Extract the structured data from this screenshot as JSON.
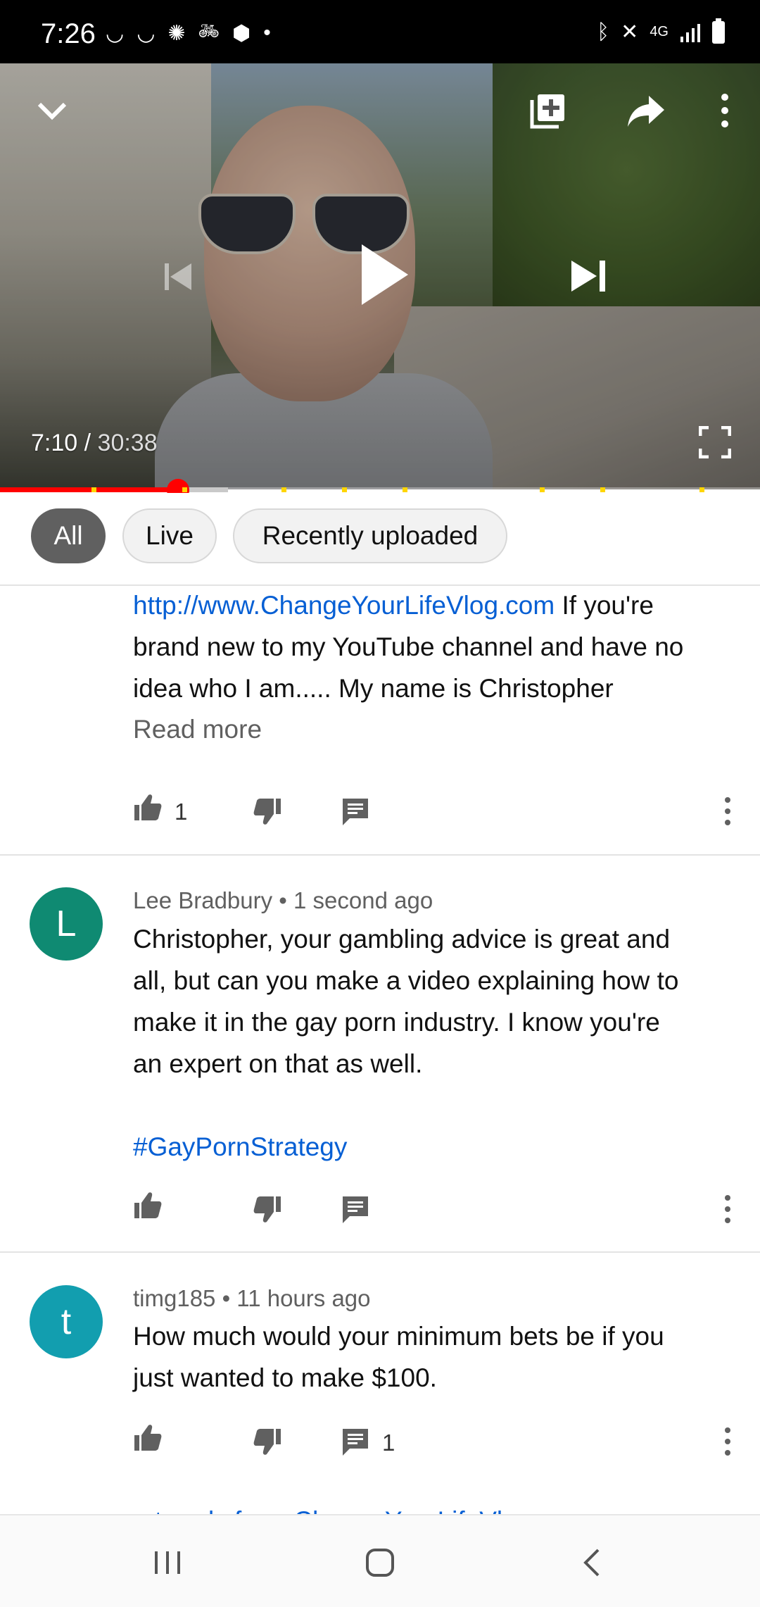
{
  "status_bar": {
    "time": "7:26",
    "left_icons": [
      "moon-icon",
      "moon-icon",
      "sync-icon",
      "bike-icon",
      "bank-icon",
      "dot-icon"
    ],
    "right_icons": [
      "bluetooth-icon",
      "mute-icon",
      "4g-icon",
      "signal-icon",
      "battery-icon"
    ],
    "network_label": "4G"
  },
  "player": {
    "current_time": "7:10",
    "separator": " / ",
    "duration": "30:38",
    "progress_fraction": 0.234,
    "buffered_fraction": 0.3,
    "ad_markers": [
      0.12,
      0.24,
      0.37,
      0.45,
      0.53,
      0.71,
      0.79,
      0.92
    ],
    "accent_color": "#ff0000",
    "marker_color": "#ffd600"
  },
  "filters": {
    "chips": [
      {
        "label": "All",
        "selected": true
      },
      {
        "label": "Live",
        "selected": false
      },
      {
        "label": "Recently uploaded",
        "selected": false
      }
    ]
  },
  "description": {
    "link": "http://www.ChangeYourLifeVlog.com",
    "text_line1_rest": " If you're",
    "text_line2": "brand new to my YouTube channel and have no",
    "text_line3": "idea who I am..... My name is Christopher",
    "read_more": "Read more",
    "like_count": "1"
  },
  "comments": [
    {
      "author": "Lee Bradbury",
      "time": "1 second ago",
      "avatar_letter": "L",
      "avatar_color": "#0f8a72",
      "lines": [
        "Christopher, your gambling advice is great and",
        "all, but can you make a video explaining how to",
        "make it in the gay porn industry. I know you're",
        "an expert on that as well."
      ],
      "hashtag": "#GayPornStrategy"
    },
    {
      "author": "timg185",
      "time": "11 hours ago",
      "avatar_letter": "t",
      "avatar_color": "#129eaf",
      "lines": [
        "How much would your minimum bets be if you",
        "just wanted to make $100."
      ],
      "reply_count": "1"
    }
  ],
  "meta_separator": " • ",
  "next_cut_text": "...trends from ChangeYourLifeVl...",
  "navbar": {
    "icons": [
      "recent-apps-icon",
      "home-icon",
      "back-icon"
    ]
  }
}
